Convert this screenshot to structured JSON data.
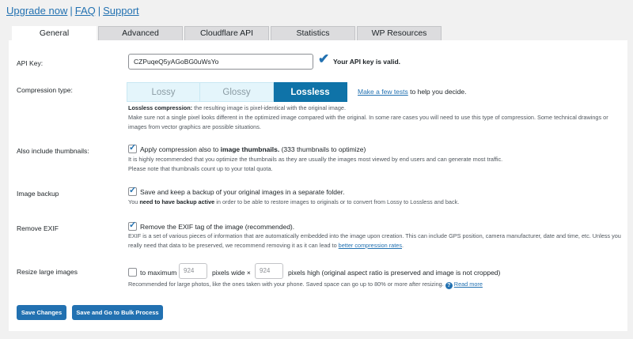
{
  "top_links": {
    "upgrade": "Upgrade now",
    "faq": "FAQ",
    "support": "Support",
    "sep": "|"
  },
  "tabs": [
    {
      "label": "General",
      "active": true
    },
    {
      "label": "Advanced"
    },
    {
      "label": "Cloudflare API"
    },
    {
      "label": "Statistics"
    },
    {
      "label": "WP Resources"
    }
  ],
  "api_key": {
    "label": "API Key:",
    "value": "CZPuqeQ5yAGoBG0uWsYo",
    "status": "Your API key is valid."
  },
  "compression": {
    "label": "Compression type:",
    "options": [
      "Lossy",
      "Glossy",
      "Lossless"
    ],
    "selected": "Lossless",
    "tests_link": "Make a few tests",
    "tests_suffix": " to help you decide.",
    "desc_bold": "Lossless compression:",
    "desc1": " the resulting image is pixel-identical with the original image.",
    "desc2": "Make sure not a single pixel looks different in the optimized image compared with the original. In some rare cases you will need to use this type of compression. Some technical drawings or images from vector graphics are possible situations."
  },
  "thumbnails": {
    "label": "Also include thumbnails:",
    "checked": true,
    "text_prefix": "Apply compression also to ",
    "text_bold": "image thumbnails.",
    "text_suffix": " (333 thumbnails to optimize)",
    "desc1": "It is highly recommended that you optimize the thumbnails as they are usually the images most viewed by end users and can generate most traffic.",
    "desc2": "Please note that thumbnails count up to your total quota."
  },
  "backup": {
    "label": "Image backup",
    "checked": true,
    "text": "Save and keep a backup of your original images in a separate folder.",
    "desc_prefix": "You ",
    "desc_bold": "need to have backup active",
    "desc_suffix": " in order to be able to restore images to originals or to convert from Lossy to Lossless and back."
  },
  "exif": {
    "label": "Remove EXIF",
    "checked": true,
    "text": "Remove the EXIF tag of the image (recommended).",
    "desc": "EXIF is a set of various pieces of information that are automatically embedded into the image upon creation. This can include GPS position, camera manufacturer, date and time, etc. Unless you really need that data to be preserved, we recommend removing it as it can lead to ",
    "desc_link": "better compression rates",
    "desc_end": "."
  },
  "resize": {
    "label": "Resize large images",
    "checked": false,
    "to_max": "to maximum",
    "width": "924",
    "wide_text": "pixels wide ×",
    "height": "924",
    "high_text": "pixels high (original aspect ratio is preserved and image is not cropped)",
    "desc": "Recommended for large photos, like the ones taken with your phone. Saved space can go up to 80% or more after resizing.",
    "help_glyph": "?",
    "read_more": "Read more"
  },
  "buttons": {
    "save": "Save Changes",
    "save_bulk": "Save and Go to Bulk Process"
  },
  "colors": {
    "accent": "#2271b1",
    "selected_segment": "#0f73a8",
    "segment_bg": "#e4f5fb"
  }
}
